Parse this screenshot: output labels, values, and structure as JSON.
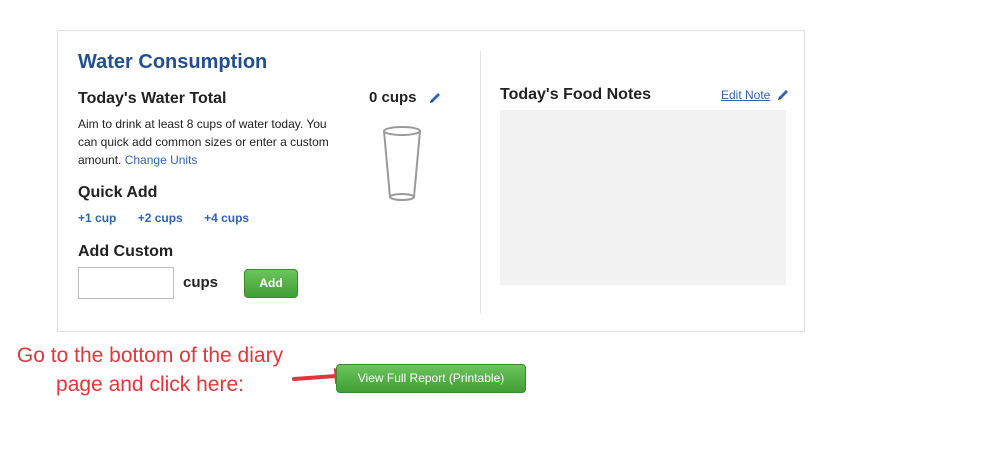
{
  "water": {
    "title": "Water Consumption",
    "total_label": "Today's Water Total",
    "total_value": "0 cups",
    "description": "Aim to drink at least 8 cups of water today. You can quick add common sizes or enter a custom amount.",
    "change_units": "Change Units",
    "quick_add_label": "Quick Add",
    "quick_add_options": [
      "+1 cup",
      "+2 cups",
      "+4 cups"
    ],
    "custom_label": "Add Custom",
    "custom_value": "",
    "custom_unit": "cups",
    "add_button": "Add"
  },
  "notes": {
    "title": "Today's Food Notes",
    "edit_link": "Edit Note",
    "content": ""
  },
  "annotation": {
    "text": "Go to the bottom of the diary page and click here:",
    "color": "#e2353c"
  },
  "report_button": "View Full Report (Printable)",
  "icons": [
    "pencil-icon",
    "water-glass-icon",
    "arrow-icon"
  ],
  "colors": {
    "title": "#22508e",
    "link": "#2f64b0",
    "button": "#4aa83e"
  }
}
